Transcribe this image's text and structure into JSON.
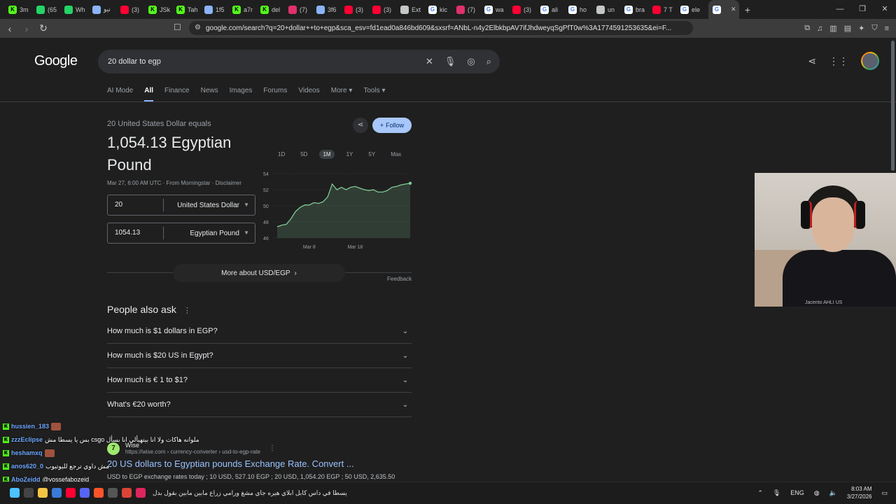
{
  "browser": {
    "tabs": [
      {
        "label": "3m",
        "icon": "kick",
        "color": "#53fc18"
      },
      {
        "label": "(65",
        "icon": "whatsapp",
        "color": "#25d366"
      },
      {
        "label": "Wh",
        "icon": "whatsapp",
        "color": "#25d366"
      },
      {
        "label": "نيو",
        "icon": "globe",
        "color": "#8ab4f8"
      },
      {
        "label": "(3)",
        "icon": "youtube",
        "color": "#ff0033"
      },
      {
        "label": "JSk",
        "icon": "kick",
        "color": "#53fc18"
      },
      {
        "label": "Tah",
        "icon": "kick",
        "color": "#53fc18"
      },
      {
        "label": "1f5",
        "icon": "globe",
        "color": "#8ab4f8"
      },
      {
        "label": "a7r",
        "icon": "kick",
        "color": "#53fc18"
      },
      {
        "label": "del",
        "icon": "kick",
        "color": "#53fc18"
      },
      {
        "label": "(7)",
        "icon": "instagram",
        "color": "#e1306c"
      },
      {
        "label": "3f6",
        "icon": "globe",
        "color": "#8ab4f8"
      },
      {
        "label": "(3)",
        "icon": "youtube",
        "color": "#ff0033"
      },
      {
        "label": "(3)",
        "icon": "youtube",
        "color": "#ff0033"
      },
      {
        "label": "Ext",
        "icon": "puzzle",
        "color": "#c4c7c5"
      },
      {
        "label": "kic",
        "icon": "google",
        "color": "#ffffff"
      },
      {
        "label": "(7)",
        "icon": "instagram",
        "color": "#e1306c"
      },
      {
        "label": "wa",
        "icon": "google",
        "color": "#ffffff"
      },
      {
        "label": "(3)",
        "icon": "youtube",
        "color": "#ff0033"
      },
      {
        "label": "ali",
        "icon": "google",
        "color": "#ffffff"
      },
      {
        "label": "ho",
        "icon": "google",
        "color": "#ffffff"
      },
      {
        "label": "un",
        "icon": "news",
        "color": "#c4c7c5"
      },
      {
        "label": "bra",
        "icon": "google",
        "color": "#ffffff"
      },
      {
        "label": "7 T",
        "icon": "play",
        "color": "#ff0033"
      },
      {
        "label": "ele",
        "icon": "google",
        "color": "#ffffff"
      },
      {
        "label": "",
        "icon": "google",
        "color": "#ffffff",
        "active": true
      }
    ],
    "url": "google.com/search?q=20+dollar++to+egp&sca_esv=fd1ead0a846bd609&sxsrf=ANbL-n4y2ElbkbpAV7ifJhdweyqSgPfT0w%3A1774591253635&ei=F..."
  },
  "search": {
    "logo": "Google",
    "query": "20 dollar to egp"
  },
  "nav_tabs": [
    "AI Mode",
    "All",
    "Finance",
    "News",
    "Images",
    "Forums",
    "Videos",
    "More",
    "Tools"
  ],
  "converter": {
    "subtitle": "20 United States Dollar equals",
    "result": "1,054.13 Egyptian Pound",
    "meta": "Mar 27, 6:00 AM UTC · From Morningstar · Disclaimer",
    "from_amount": "20",
    "from_currency": "United States Dollar",
    "to_amount": "1054.13",
    "to_currency": "Egyptian Pound",
    "follow_label": "Follow",
    "ranges": [
      "1D",
      "5D",
      "1M",
      "1Y",
      "5Y",
      "Max"
    ],
    "selected_range": "1M",
    "more_label": "More about USD/EGP",
    "feedback": "Feedback"
  },
  "chart_data": {
    "type": "area",
    "y_ticks": [
      "54",
      "52",
      "50",
      "48",
      "46"
    ],
    "ylim": [
      46,
      54
    ],
    "x_ticks": [
      "Mar 8",
      "Mar 18"
    ],
    "values": [
      47.4,
      47.6,
      47.7,
      48.4,
      49.3,
      49.8,
      50.1,
      50.1,
      50.4,
      50.3,
      50.5,
      51.1,
      52.7,
      52.0,
      52.3,
      52.0,
      52.3,
      52.4,
      52.2,
      52.0,
      51.9,
      52.0,
      51.7,
      51.7,
      51.9,
      52.3,
      52.4,
      52.6,
      52.7,
      52.8
    ],
    "line_color": "#81c995"
  },
  "paa": {
    "title": "People also ask",
    "questions": [
      "How much is $1 dollars in EGP?",
      "How much is $20 US in Egypt?",
      "How much is € 1 to $1?",
      "What's €20 worth?"
    ]
  },
  "result": {
    "site_name": "Wise",
    "url": "https://wise.com › currency-converter › usd-to-egp-rate",
    "title": "20 US dollars to Egyptian pounds Exchange Rate. Convert ...",
    "snippet": "USD to EGP exchange rates today ; 10 USD, 527.10 EGP ; 20 USD, 1,054.20 EGP ; 50 USD, 2,635.50"
  },
  "chat": [
    {
      "user": "hussien_183",
      "msg": ""
    },
    {
      "user": "zzzEclipse",
      "msg": "بس يا يسطا مش csgo ملوانه هاكات ولا انا بيتهيألي انا بسأل"
    },
    {
      "user": "heshamxq",
      "msg": ""
    },
    {
      "user": "anos620_0",
      "msg": "مش داوي ترجع لليوتيوب"
    },
    {
      "user": "AboZeidd",
      "msg": "@yossefabozeid"
    }
  ],
  "webcam": {
    "watermark": "Jacento AHLI US"
  },
  "taskbar": {
    "ticker": "يسطا في داس كابل ابلاي هيره جاي مشغ ورامي زراع مابين مابين بقول بدل",
    "lang": "ENG",
    "time": "8:03 AM",
    "date": "3/27/2026"
  }
}
